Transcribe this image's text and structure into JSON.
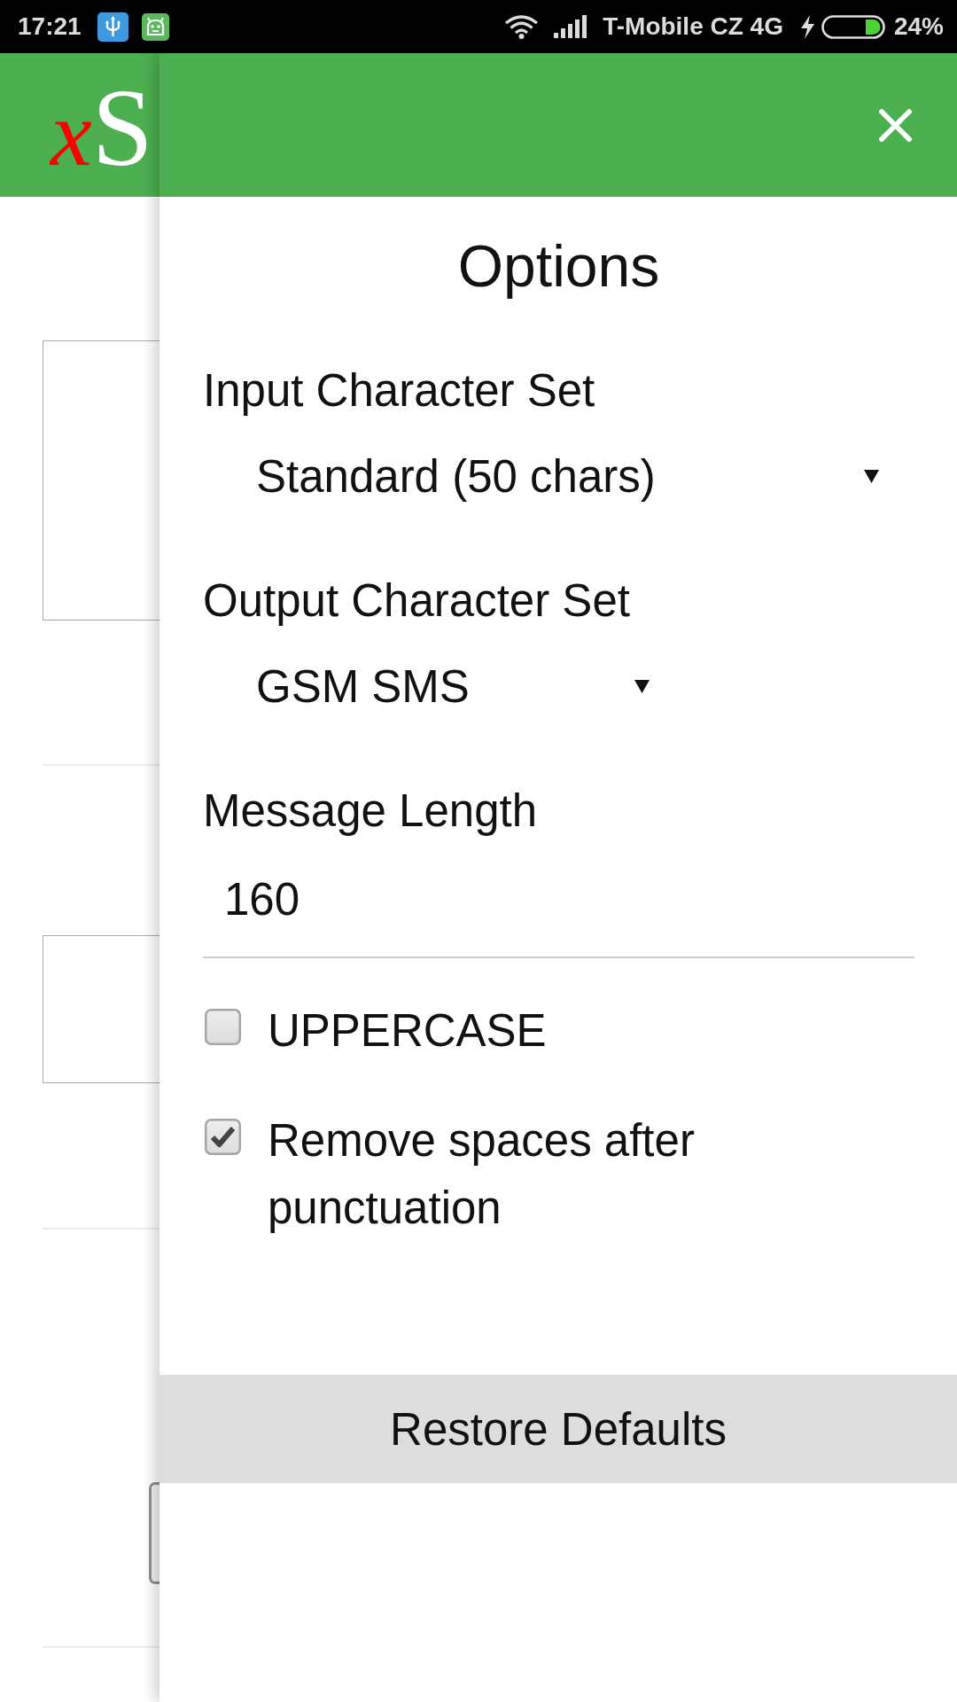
{
  "status_bar": {
    "time": "17:21",
    "carrier": "T-Mobile CZ 4G",
    "battery": "24%"
  },
  "app_bar": {
    "logo": "xS"
  },
  "drawer": {
    "title": "Options",
    "sections": [
      {
        "kind": "select",
        "label": "Input Character Set",
        "value": "Standard (50 chars)"
      },
      {
        "kind": "select",
        "label": "Output Character Set",
        "value": "GSM SMS"
      },
      {
        "kind": "input",
        "label": "Message Length",
        "value": "160"
      }
    ],
    "checkboxes": [
      {
        "label": "UPPERCASE",
        "checked": false
      },
      {
        "label": "Remove spaces after punctuation",
        "checked": true
      }
    ],
    "button": "Restore Defaults"
  }
}
